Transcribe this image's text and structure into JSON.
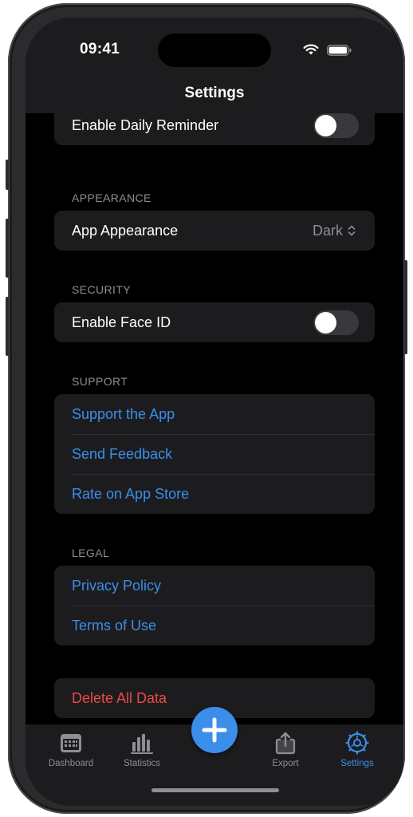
{
  "status_bar": {
    "time": "09:41",
    "icons": [
      "wifi-icon",
      "battery-icon"
    ]
  },
  "nav": {
    "title": "Settings"
  },
  "sections": {
    "reminders": {
      "daily_reminder_label": "Enable Daily Reminder",
      "daily_reminder_on": false
    },
    "appearance": {
      "header": "APPEARANCE",
      "app_appearance_label": "App Appearance",
      "app_appearance_value": "Dark"
    },
    "security": {
      "header": "SECURITY",
      "face_id_label": "Enable Face ID",
      "face_id_on": false
    },
    "support": {
      "header": "SUPPORT",
      "items": [
        "Support the App",
        "Send Feedback",
        "Rate on App Store"
      ]
    },
    "legal": {
      "header": "LEGAL",
      "items": [
        "Privacy Policy",
        "Terms of Use"
      ]
    },
    "danger": {
      "delete_label": "Delete All Data"
    }
  },
  "tab_bar": {
    "tabs": [
      {
        "label": "Dashboard",
        "icon": "calendar-icon",
        "active": false
      },
      {
        "label": "Statistics",
        "icon": "bar-chart-icon",
        "active": false
      },
      {
        "label": "Export",
        "icon": "share-icon",
        "active": false
      },
      {
        "label": "Settings",
        "icon": "gear-icon",
        "active": true
      }
    ],
    "add_button_icon": "plus-icon"
  },
  "colors": {
    "background": "#000000",
    "card": "#1c1c1e",
    "accent": "#3b8eea",
    "destructive": "#eb4a45",
    "secondary_text": "#8e8e93"
  }
}
